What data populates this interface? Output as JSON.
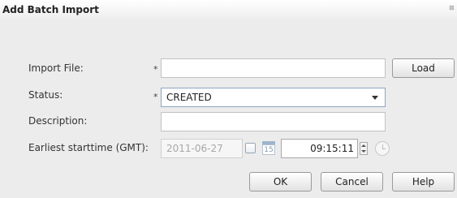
{
  "dialog": {
    "title": "Add Batch Import",
    "close_glyph": "⊠"
  },
  "form": {
    "import_file": {
      "label": "Import File:",
      "required_marker": "*",
      "value": "",
      "load_label": "Load"
    },
    "status": {
      "label": "Status:",
      "required_marker": "*",
      "value": "CREATED"
    },
    "description": {
      "label": "Description:",
      "value": ""
    },
    "earliest_starttime": {
      "label": "Earliest starttime (GMT):",
      "date": "2011-06-27",
      "calendar_day": "15",
      "time": "09:15:11"
    }
  },
  "buttons": {
    "ok": "OK",
    "cancel": "Cancel",
    "help": "Help"
  },
  "icons": [
    "close-icon",
    "calendar-icon",
    "spinner-icon",
    "clock-icon",
    "dropdown-arrow-icon"
  ]
}
